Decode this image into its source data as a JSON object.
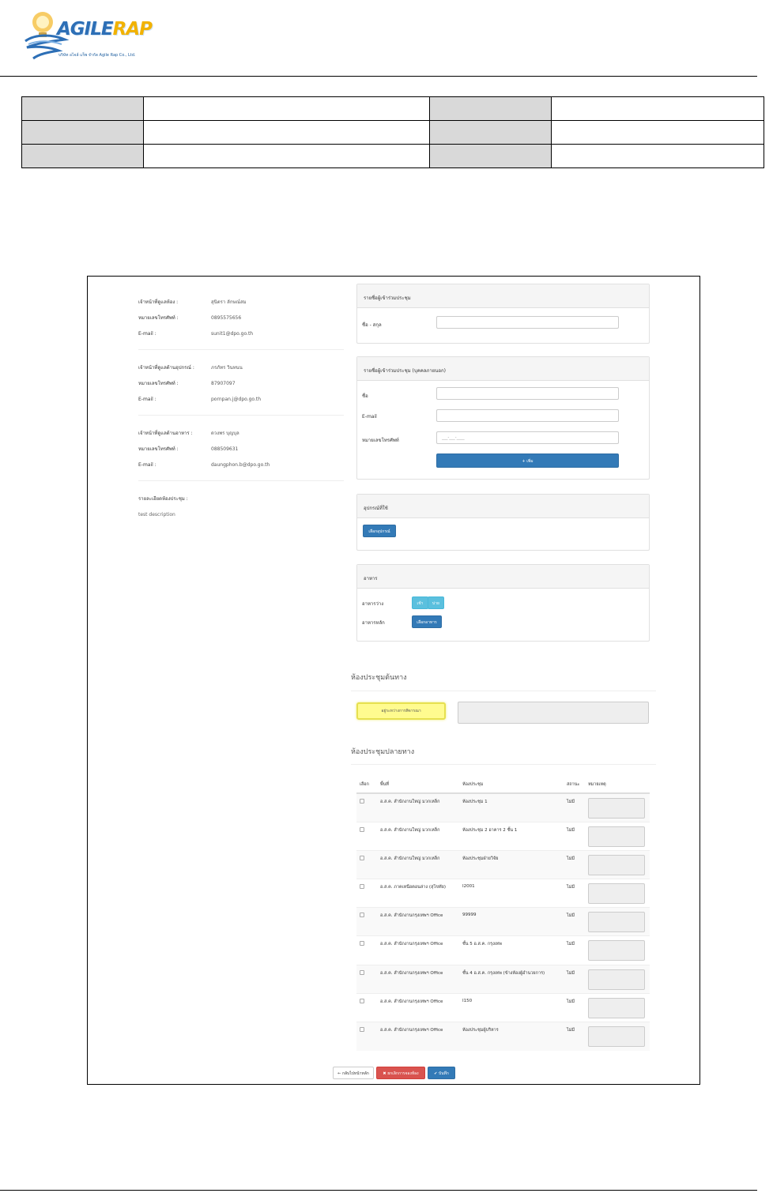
{
  "logo": {
    "name_a": "AGILE",
    "name_b": "RAP",
    "tagline": "บริษัท อไจล์ แร็พ จำกัด Agile Rap Co., Ltd."
  },
  "left_column": {
    "room_officer_label": "เจ้าหน้าที่ดูแลห้อง :",
    "room_officer_name": "สุนิตรา ลักษณ์สม",
    "room_phone_label": "หมายเลขโทรศัพท์ :",
    "room_phone": "0895575656",
    "room_email_label": "E-mail :",
    "room_email": "sunit1@dpo.go.th",
    "equip_officer_label": "เจ้าหน้าที่ดูแลด้านอุปกรณ์ :",
    "equip_officer_name": "ภรภัทร วินทนน",
    "equip_phone_label": "หมายเลขโทรศัพท์ :",
    "equip_phone": "87907097",
    "equip_email_label": "E-mail :",
    "equip_email": "pornpan.j@dpo.go.th",
    "food_officer_label": "เจ้าหน้าที่ดูแลด้านอาหาร :",
    "food_officer_name": "ดวงพร บุญบุล",
    "food_phone_label": "หมายเลขโทรศัพท์ :",
    "food_phone": "088509631",
    "food_email_label": "E-mail :",
    "food_email": "daungphon.b@dpo.go.th",
    "room_detail_label": "รายละเอียดห้องประชุม :",
    "room_detail": "test description"
  },
  "participants": {
    "header": "รายชื่อผู้เข้าร่วมประชุม",
    "name_label": "ชื่อ - สกุล"
  },
  "external": {
    "header": "รายชื่อผู้เข้าร่วมประชุม (บุคคลภายนอก)",
    "name_label": "ชื่อ",
    "email_label": "E-mail",
    "phone_label": "หมายเลขโทรศัพท์",
    "phone_placeholder": "___-___-____",
    "add_button": "+ เพิ่ม"
  },
  "equipment": {
    "header": "อุปกรณ์ที่ใช้",
    "select_button": "เลือกอุปกรณ์"
  },
  "food": {
    "header": "อาหาร",
    "snack_label": "อาหารว่าง",
    "snack_morning": "เช้า",
    "snack_afternoon": "บ่าย",
    "main_label": "อาหารหลัก",
    "main_button": "เลือกอาหาร"
  },
  "origin": {
    "title": "ห้องประชุมต้นทาง",
    "status": "อยู่ระหว่างการพิจารณา"
  },
  "destination": {
    "title": "ห้องประชุมปลายทาง",
    "columns": [
      "เลือก",
      "พื้นที่",
      "ห้องประชุม",
      "สถานะ",
      "หมายเหตุ"
    ],
    "rows": [
      {
        "area": "อ.ส.ค. สำนักงานใหญ่ มวกเหล็ก",
        "room": "ห้องประชุม 1",
        "status": "ไม่มี"
      },
      {
        "area": "อ.ส.ค. สำนักงานใหญ่ มวกเหล็ก",
        "room": "ห้องประชุม 2 อาคาร 2 ชั้น 1",
        "status": "ไม่มี"
      },
      {
        "area": "อ.ส.ค. สำนักงานใหญ่ มวกเหล็ก",
        "room": "ห้องประชุมฝ่ายวิจัย",
        "status": "ไม่มี"
      },
      {
        "area": "อ.ส.ค. ภาคเหนือตอนล่าง (สุโขทัย)",
        "room": "I2001",
        "status": "ไม่มี"
      },
      {
        "area": "อ.ส.ค. สำนักงานกรุงเทพฯ Office",
        "room": "99999",
        "status": "ไม่มี"
      },
      {
        "area": "อ.ส.ค. สำนักงานกรุงเทพฯ Office",
        "room": "ชั้น 5 อ.ส.ค. กรุงเทพ",
        "status": "ไม่มี"
      },
      {
        "area": "อ.ส.ค. สำนักงานกรุงเทพฯ Office",
        "room": "ชั้น 4 อ.ส.ค. กรุงเทพ (ข้างห้องผู้อำนวยการ)",
        "status": "ไม่มี"
      },
      {
        "area": "อ.ส.ค. สำนักงานกรุงเทพฯ Office",
        "room": "I150",
        "status": "ไม่มี"
      },
      {
        "area": "อ.ส.ค. สำนักงานกรุงเทพฯ Office",
        "room": "ห้องประชุมผู้บริหาร",
        "status": "ไม่มี"
      }
    ]
  },
  "actions": {
    "back": "กลับไปหน้าหลัก",
    "cancel": "ยกเลิกการจองห้อง",
    "save": "บันทึก"
  }
}
